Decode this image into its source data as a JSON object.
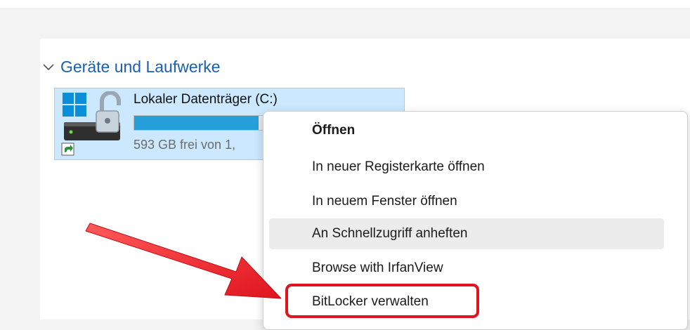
{
  "section": {
    "title": "Geräte und Laufwerke"
  },
  "drive": {
    "name": "Lokaler Datenträger (C:)",
    "free_text": "593 GB frei von 1,",
    "used_fraction": 0.47,
    "bar_color": "#26a0da"
  },
  "context_menu": {
    "items": [
      {
        "label": "Öffnen"
      },
      {
        "label": "In neuer Registerkarte öffnen"
      },
      {
        "label": "In neuem Fenster öffnen"
      },
      {
        "label": "An Schnellzugriff anheften"
      },
      {
        "label": "Browse with IrfanView"
      },
      {
        "label": "BitLocker verwalten"
      }
    ]
  },
  "annotation": {
    "color": "#e0141e"
  },
  "icons": {
    "chevron": "chevron-down-icon",
    "drive": "windows-drive-icon",
    "lock": "unlocked-padlock-icon",
    "shortcut": "shortcut-arrow-icon"
  }
}
